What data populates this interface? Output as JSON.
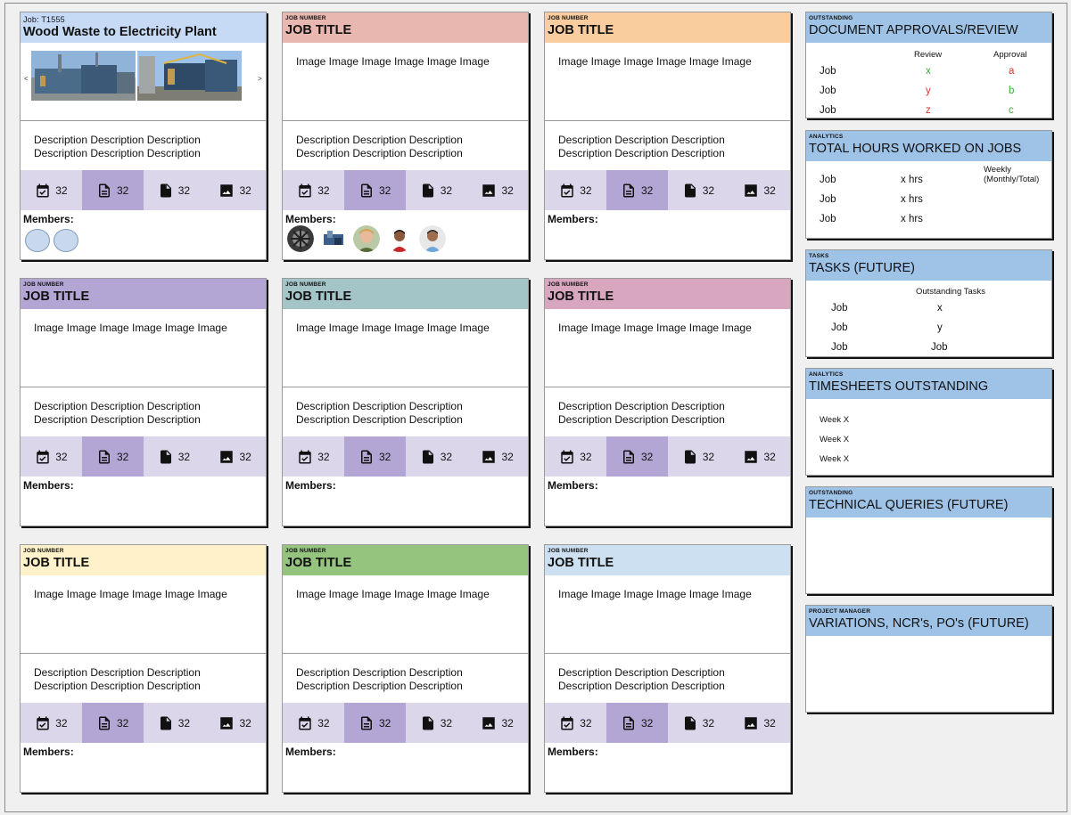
{
  "colors": {
    "card1_head": "#c6daf6",
    "card2_head": "#e8b7b0",
    "card3_head": "#f9cd9e",
    "card4_head": "#b3a6d5",
    "card5_head": "#a4c5c8",
    "card6_head": "#d8a6bf",
    "card7_head": "#fff1c9",
    "card8_head": "#94c47e",
    "card9_head": "#cde0f1",
    "panel_head": "#9fc3e7",
    "stats_bg": "#dcd6ea",
    "stats_active": "#b3a6d5"
  },
  "cards": [
    {
      "subtitle": "Job: T1555",
      "title": "Wood Waste to Electricity Plant",
      "image_text": "",
      "prev_arrow": "<",
      "next_arrow": ">",
      "desc1": "Description Description Description",
      "desc2": "Description Description Description",
      "stats": [
        "32",
        "32",
        "32",
        "32"
      ],
      "members_label": "Members:"
    },
    {
      "subtitle": "JOB NUMBER",
      "title": "JOB TITLE",
      "image_text": "Image Image Image Image Image Image",
      "desc1": "Description Description Description",
      "desc2": "Description Description Description",
      "stats": [
        "32",
        "32",
        "32",
        "32"
      ],
      "members_label": "Members:"
    },
    {
      "subtitle": "JOB NUMBER",
      "title": "JOB TITLE",
      "image_text": "Image Image Image Image Image Image",
      "desc1": "Description Description Description",
      "desc2": "Description Description Description",
      "stats": [
        "32",
        "32",
        "32",
        "32"
      ],
      "members_label": "Members:"
    },
    {
      "subtitle": "JOB NUMBER",
      "title": "JOB TITLE",
      "image_text": "Image Image Image Image Image Image",
      "desc1": "Description Description Description",
      "desc2": "Description Description Description",
      "stats": [
        "32",
        "32",
        "32",
        "32"
      ],
      "members_label": "Members:"
    },
    {
      "subtitle": "JOB NUMBER",
      "title": "JOB TITLE",
      "image_text": "Image Image Image Image Image Image",
      "desc1": "Description Description Description",
      "desc2": "Description Description Description",
      "stats": [
        "32",
        "32",
        "32",
        "32"
      ],
      "members_label": "Members:"
    },
    {
      "subtitle": "JOB NUMBER",
      "title": "JOB TITLE",
      "image_text": "Image Image Image Image Image Image",
      "desc1": "Description Description Description",
      "desc2": "Description Description Description",
      "stats": [
        "32",
        "32",
        "32",
        "32"
      ],
      "members_label": "Members:"
    },
    {
      "subtitle": "JOB NUMBER",
      "title": "JOB TITLE",
      "image_text": "Image Image Image Image Image Image",
      "desc1": "Description Description Description",
      "desc2": "Description Description Description",
      "stats": [
        "32",
        "32",
        "32",
        "32"
      ],
      "members_label": "Members:"
    },
    {
      "subtitle": "JOB NUMBER",
      "title": "JOB TITLE",
      "image_text": "Image Image Image Image Image Image",
      "desc1": "Description Description Description",
      "desc2": "Description Description Description",
      "stats": [
        "32",
        "32",
        "32",
        "32"
      ],
      "members_label": "Members:"
    },
    {
      "subtitle": "JOB NUMBER",
      "title": "JOB TITLE",
      "image_text": "Image Image Image Image Image Image",
      "desc1": "Description Description Description",
      "desc2": "Description Description Description",
      "stats": [
        "32",
        "32",
        "32",
        "32"
      ],
      "members_label": "Members:"
    }
  ],
  "stat_icons": [
    "calendar-check-icon",
    "document-icon",
    "file-transfer-icon",
    "image-icon"
  ],
  "panels": {
    "approvals": {
      "subtitle": "OUTSTANDING",
      "title": "DOCUMENT APPROVALS/REVIEW",
      "col_review": "Review",
      "col_approval": "Approval",
      "rows": [
        {
          "job": "Job",
          "review": "x",
          "approval": "a"
        },
        {
          "job": "Job",
          "review": "y",
          "approval": "b"
        },
        {
          "job": "Job",
          "review": "z",
          "approval": "c"
        }
      ]
    },
    "hours": {
      "subtitle": "ANALYTICS",
      "title": "TOTAL HOURS WORKED ON JOBS",
      "note1": "Weekly",
      "note2": "(Monthly/Total)",
      "rows": [
        {
          "job": "Job",
          "hrs": "x hrs"
        },
        {
          "job": "Job",
          "hrs": "x hrs"
        },
        {
          "job": "Job",
          "hrs": "x hrs"
        }
      ]
    },
    "tasks": {
      "subtitle": "TASKS",
      "title": "TASKS (FUTURE)",
      "col": "Outstanding Tasks",
      "rows": [
        {
          "job": "Job",
          "val": "x"
        },
        {
          "job": "Job",
          "val": "y"
        },
        {
          "job": "Job",
          "val": "Job"
        }
      ]
    },
    "timesheets": {
      "subtitle": "ANALYTICS",
      "title": "TIMESHEETS OUTSTANDING",
      "rows": [
        "Week X",
        "Week X",
        "Week X"
      ]
    },
    "queries": {
      "subtitle": "OUTSTANDING",
      "title": "TECHNICAL QUERIES (FUTURE)"
    },
    "variations": {
      "subtitle": "PROJECT MANAGER",
      "title": "VARIATIONS, NCR's, PO's (FUTURE)"
    }
  }
}
